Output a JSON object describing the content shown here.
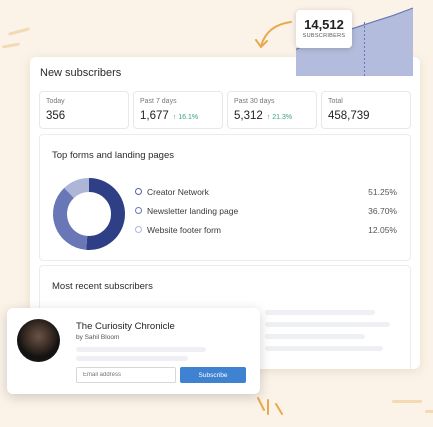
{
  "colors": {
    "background": "#fbf3e8",
    "accent_navy": "#2f3f85",
    "accent_blue": "#6977b7",
    "accent_light": "#aeb6d8",
    "positive_green": "#3aa37c",
    "button_blue": "#3e82d1"
  },
  "main_card": {
    "title": "New subscribers",
    "stats": [
      {
        "label": "Today",
        "value": "356",
        "change": ""
      },
      {
        "label": "Past 7 days",
        "value": "1,677",
        "change": "↑ 16.1%"
      },
      {
        "label": "Past 30 days",
        "value": "5,312",
        "change": "↑ 21.3%"
      },
      {
        "label": "Total",
        "value": "458,739",
        "change": ""
      }
    ]
  },
  "top_forms": {
    "title": "Top forms and landing pages",
    "items": [
      {
        "name": "Creator Network",
        "percent": "51.25%"
      },
      {
        "name": "Newsletter landing page",
        "percent": "36.70%"
      },
      {
        "name": "Website footer form",
        "percent": "12.05%"
      }
    ]
  },
  "recent": {
    "title": "Most recent subscribers"
  },
  "tooltip": {
    "value": "14,512",
    "label": "SUBSCRIBERS"
  },
  "popup": {
    "title": "The Curiosity Chronicle",
    "byline": "by Sahil Bloom",
    "email_placeholder": "Email address",
    "button_label": "Subscribe",
    "icons": {
      "avatar": "person-photo"
    }
  },
  "chart_data": [
    {
      "type": "pie",
      "title": "",
      "categories": [
        "Creator Network",
        "Newsletter landing page",
        "Website footer form"
      ],
      "values": [
        51.25,
        36.7,
        12.05
      ],
      "colors": [
        "#2f3f85",
        "#6977b7",
        "#aeb6d8"
      ],
      "legend": "right"
    },
    {
      "type": "area",
      "title": "",
      "xlabel": "",
      "ylabel": "",
      "x": [
        1,
        2,
        3,
        4,
        5,
        6,
        7
      ],
      "values": [
        0.55,
        0.72,
        0.86,
        0.99,
        1.12,
        1.25,
        1.4
      ],
      "ylim": [
        0,
        1.4
      ],
      "grid": false
    }
  ]
}
